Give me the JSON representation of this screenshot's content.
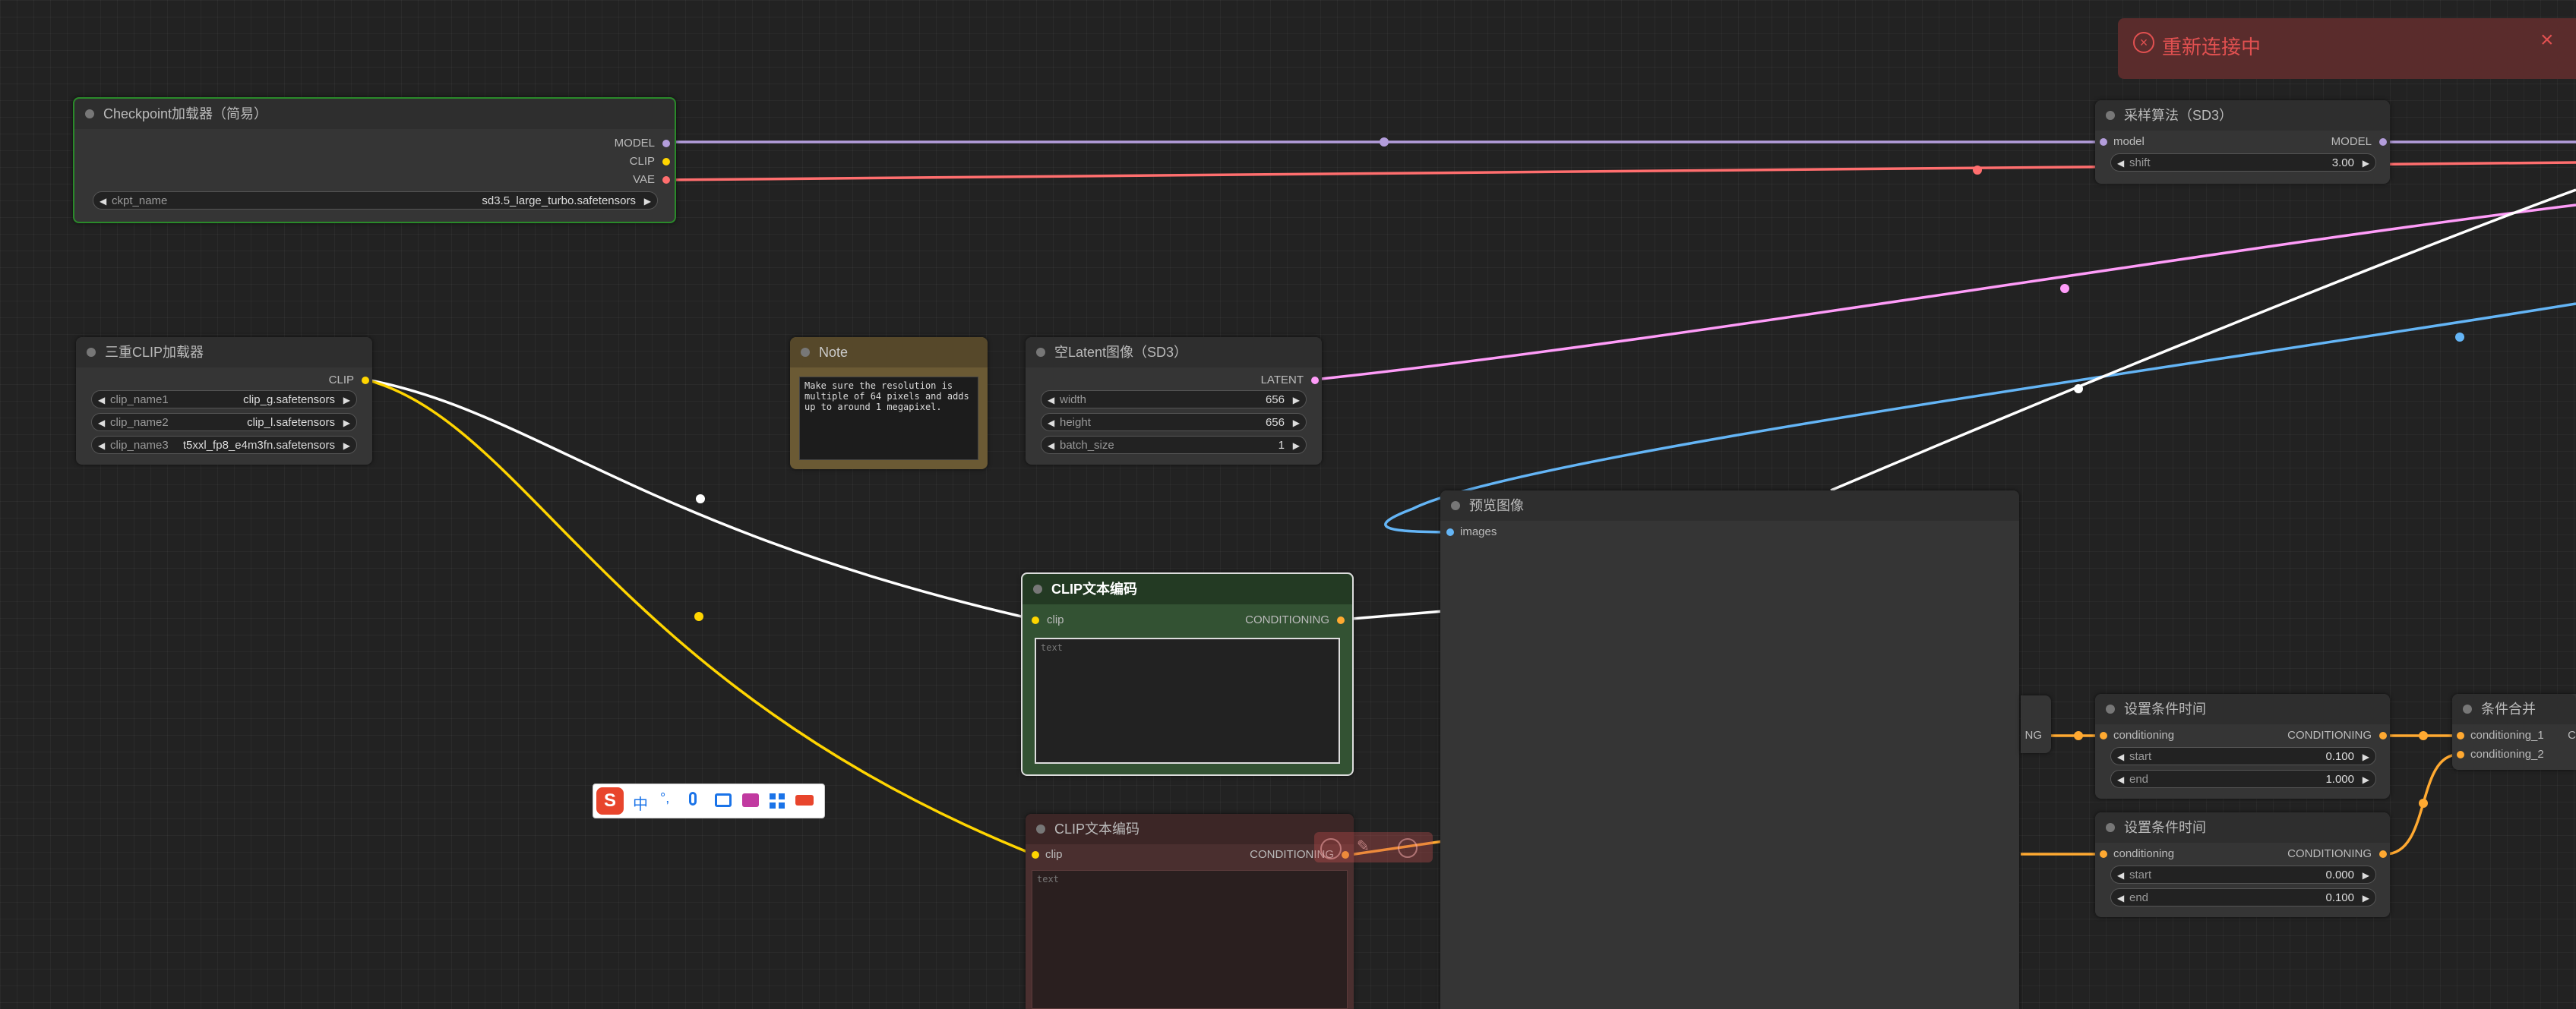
{
  "reconnect_toast": {
    "text": "重新连接中",
    "bg": "#5a2a2a",
    "accent": "#e05050"
  },
  "colors": {
    "MODEL": "#b39ddb",
    "CLIP": "#ffd500",
    "VAE": "#ff6e6e",
    "LATENT": "#ff9cf9",
    "CONDITIONING": "#ffa931",
    "IMAGE": "#64b5f6",
    "WHITE": "#ffffff"
  },
  "nodes": {
    "checkpoint": {
      "title": "Checkpoint加载器（简易）",
      "outputs": [
        "MODEL",
        "CLIP",
        "VAE"
      ],
      "widgets": [
        {
          "name": "ckpt_name",
          "value": "sd3.5_large_turbo.safetensors"
        }
      ]
    },
    "triple_clip": {
      "title": "三重CLIP加载器",
      "outputs": [
        "CLIP"
      ],
      "widgets": [
        {
          "name": "clip_name1",
          "value": "clip_g.safetensors"
        },
        {
          "name": "clip_name2",
          "value": "clip_l.safetensors"
        },
        {
          "name": "clip_name3",
          "value": "t5xxl_fp8_e4m3fn.safetensors"
        }
      ]
    },
    "note": {
      "title": "Note",
      "text": "Make sure the resolution is multiple of 64 pixels and adds up to around 1 megapixel."
    },
    "empty_latent": {
      "title": "空Latent图像（SD3）",
      "outputs": [
        "LATENT"
      ],
      "widgets": [
        {
          "name": "width",
          "value": "656"
        },
        {
          "name": "height",
          "value": "656"
        },
        {
          "name": "batch_size",
          "value": "1"
        }
      ]
    },
    "clip_text_pos": {
      "title": "CLIP文本编码",
      "input": "clip",
      "output": "CONDITIONING",
      "placeholder": "text"
    },
    "clip_text_neg": {
      "title": "CLIP文本编码",
      "input": "clip",
      "output": "CONDITIONING",
      "placeholder": "text"
    },
    "preview": {
      "title": "预览图像",
      "input": "images"
    },
    "sampling_sd3": {
      "title": "采样算法（SD3）",
      "input": "model",
      "output": "MODEL",
      "widgets": [
        {
          "name": "shift",
          "value": "3.00"
        }
      ]
    },
    "cond_time_1": {
      "title": "设置条件时间",
      "input": "conditioning",
      "output": "CONDITIONING",
      "widgets": [
        {
          "name": "start",
          "value": "0.100"
        },
        {
          "name": "end",
          "value": "1.000"
        }
      ]
    },
    "cond_time_2": {
      "title": "设置条件时间",
      "input": "conditioning",
      "output": "CONDITIONING",
      "widgets": [
        {
          "name": "start",
          "value": "0.000"
        },
        {
          "name": "end",
          "value": "0.100"
        }
      ]
    },
    "cond_combine": {
      "title": "条件合并",
      "inputs": [
        "conditioning_1",
        "conditioning_2"
      ],
      "output_partial": "C"
    },
    "partial_output": {
      "label": "NG"
    }
  },
  "ime_toolbar": {
    "items": [
      "S",
      "中",
      "°,",
      "mic",
      "keyboard",
      "skin",
      "apps",
      "tools"
    ]
  }
}
